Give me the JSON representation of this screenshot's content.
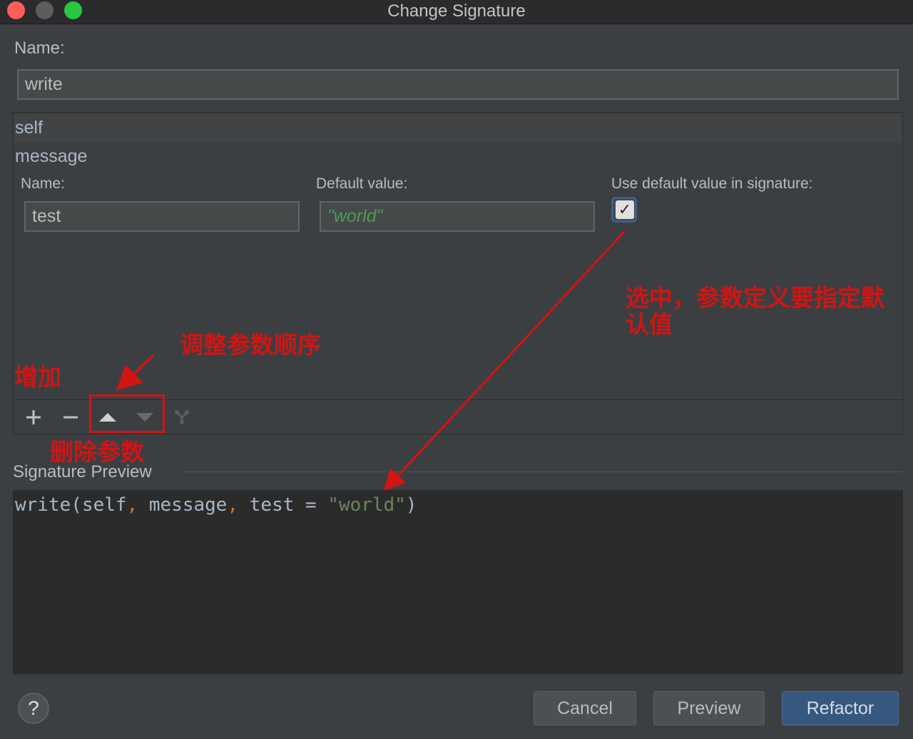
{
  "window": {
    "title": "Change Signature"
  },
  "name_section": {
    "label": "Name:",
    "value": "write"
  },
  "parameters": [
    {
      "name": "self"
    },
    {
      "name": "message"
    }
  ],
  "param_editor": {
    "name_label": "Name:",
    "name_value": "test",
    "default_label": "Default value:",
    "default_value": "\"world\"",
    "use_default_label": "Use default value in signature:",
    "use_default_checked": true
  },
  "toolbar": {
    "add_icon": "plus-icon",
    "remove_icon": "minus-icon",
    "move_up_icon": "triangle-up-icon",
    "move_down_icon": "triangle-down-icon",
    "propagate_icon": "propagate-icon"
  },
  "signature_preview": {
    "title": "Signature Preview",
    "code_fn": "write",
    "code_open": "(",
    "code_p1": "self",
    "code_sep": ", ",
    "code_p2": "message",
    "code_p3": "test = ",
    "code_str": "\"world\"",
    "code_close": ")"
  },
  "buttons": {
    "help": "?",
    "cancel": "Cancel",
    "preview": "Preview",
    "refactor": "Refactor"
  },
  "annotations": {
    "add": "增加",
    "reorder": "调整参数顺序",
    "delete": "删除参数",
    "checkbox_note": "选中，参数定义要指定默认值"
  },
  "colors": {
    "annotation_red": "#d21414",
    "string_green": "#6a8759",
    "comma_orange": "#cc7832",
    "primary_button": "#365880"
  }
}
